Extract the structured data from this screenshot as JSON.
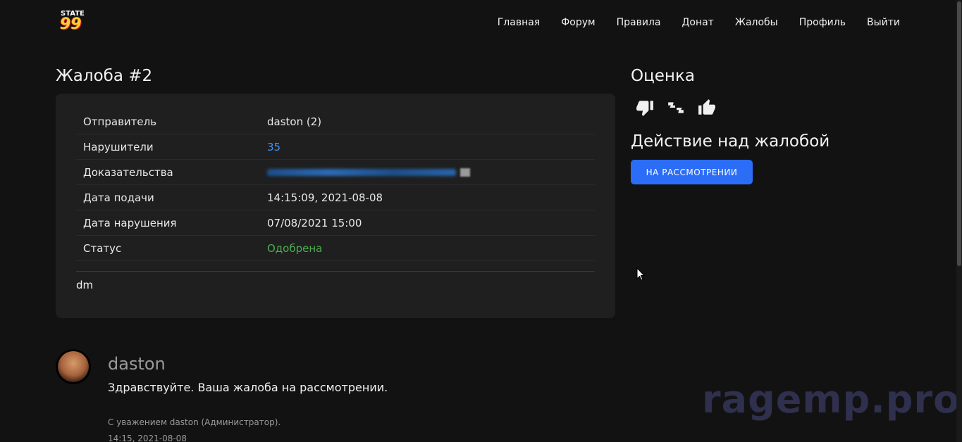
{
  "logo": {
    "top": "STATE",
    "num": "99"
  },
  "nav": [
    "Главная",
    "Форум",
    "Правила",
    "Донат",
    "Жалобы",
    "Профиль",
    "Выйти"
  ],
  "complaint": {
    "title": "Жалоба #2",
    "rows": [
      {
        "label": "Отправитель",
        "value": "daston (2)"
      },
      {
        "label": "Нарушители",
        "value": "35"
      },
      {
        "label": "Доказательства",
        "value": ""
      },
      {
        "label": "Дата подачи",
        "value": "14:15:09, 2021-08-08"
      },
      {
        "label": "Дата нарушения",
        "value": "07/08/2021 15:00"
      },
      {
        "label": "Статус",
        "value": "Одобрена"
      }
    ],
    "description": "dm",
    "colors": {
      "link": "#3d95ff",
      "status_ok": "#4caf50"
    }
  },
  "rating": {
    "title": "Оценка",
    "icons": [
      "thumbs-down-icon",
      "thumbs-neutral-icon",
      "thumbs-up-icon"
    ]
  },
  "action": {
    "title": "Действие над жалобой",
    "button": "НА РАССМОТРЕНИИ",
    "color": "#2b6df6"
  },
  "comment": {
    "author": "daston",
    "text": "Здравствуйте. Ваша жалоба на рассмотрении.",
    "signature": "С уважением daston (Администратор).",
    "date": "14:15, 2021-08-08"
  },
  "watermark": "ragemp.pro"
}
